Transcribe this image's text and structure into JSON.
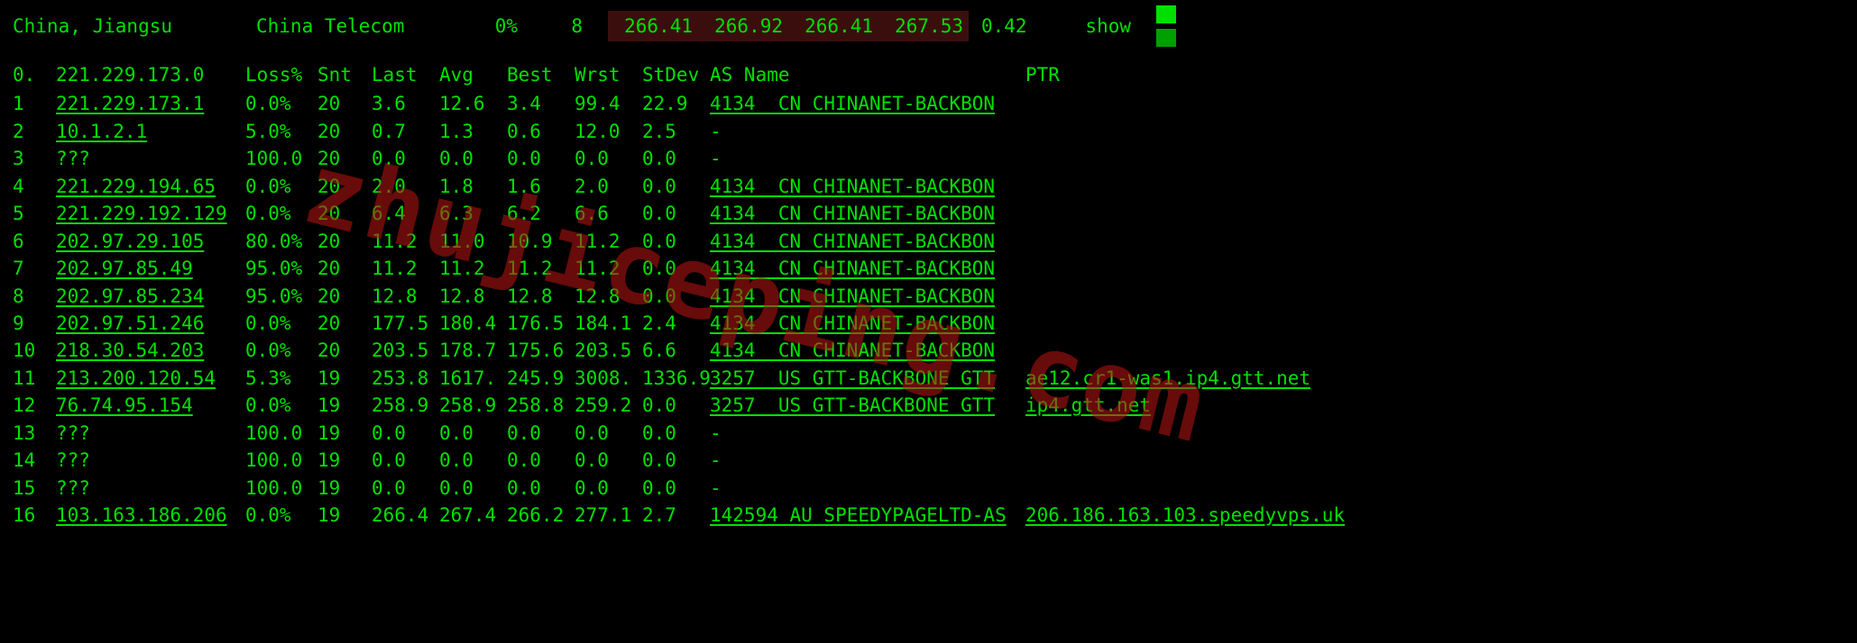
{
  "watermark": "zhujiceping.com",
  "status": {
    "location": "China, Jiangsu",
    "isp": "China Telecom",
    "loss_pct": "0%",
    "count": "8",
    "lat1": "266.41",
    "lat2": "266.92",
    "lat3": "266.41",
    "lat4": "267.53",
    "stdev": "0.42",
    "action": "show"
  },
  "headers": {
    "hop": "0.",
    "ip": "221.229.173.0",
    "loss": "Loss%",
    "snt": "Snt",
    "last": "Last",
    "avg": "Avg",
    "best": "Best",
    "wrst": "Wrst",
    "stdev": "StDev",
    "asname": "AS Name",
    "ptr": "PTR"
  },
  "hops": [
    {
      "n": "1",
      "ip": "221.229.173.1",
      "loss": "0.0%",
      "snt": "20",
      "last": "3.6",
      "avg": "12.6",
      "best": "3.4",
      "wrst": "99.4",
      "stdev": "22.9",
      "as": "4134  CN CHINANET-BACKBON",
      "ptr": ""
    },
    {
      "n": "2",
      "ip": "10.1.2.1",
      "loss": "5.0%",
      "snt": "20",
      "last": "0.7",
      "avg": "1.3",
      "best": "0.6",
      "wrst": "12.0",
      "stdev": "2.5",
      "as": "-",
      "ptr": ""
    },
    {
      "n": "3",
      "ip": "???",
      "loss": "100.0",
      "snt": "20",
      "last": "0.0",
      "avg": "0.0",
      "best": "0.0",
      "wrst": "0.0",
      "stdev": "0.0",
      "as": "-",
      "ptr": ""
    },
    {
      "n": "4",
      "ip": "221.229.194.65",
      "loss": "0.0%",
      "snt": "20",
      "last": "2.0",
      "avg": "1.8",
      "best": "1.6",
      "wrst": "2.0",
      "stdev": "0.0",
      "as": "4134  CN CHINANET-BACKBON",
      "ptr": ""
    },
    {
      "n": "5",
      "ip": "221.229.192.129",
      "loss": "0.0%",
      "snt": "20",
      "last": "6.4",
      "avg": "6.3",
      "best": "6.2",
      "wrst": "6.6",
      "stdev": "0.0",
      "as": "4134  CN CHINANET-BACKBON",
      "ptr": ""
    },
    {
      "n": "6",
      "ip": "202.97.29.105",
      "loss": "80.0%",
      "snt": "20",
      "last": "11.2",
      "avg": "11.0",
      "best": "10.9",
      "wrst": "11.2",
      "stdev": "0.0",
      "as": "4134  CN CHINANET-BACKBON",
      "ptr": ""
    },
    {
      "n": "7",
      "ip": "202.97.85.49",
      "loss": "95.0%",
      "snt": "20",
      "last": "11.2",
      "avg": "11.2",
      "best": "11.2",
      "wrst": "11.2",
      "stdev": "0.0",
      "as": "4134  CN CHINANET-BACKBON",
      "ptr": ""
    },
    {
      "n": "8",
      "ip": "202.97.85.234",
      "loss": "95.0%",
      "snt": "20",
      "last": "12.8",
      "avg": "12.8",
      "best": "12.8",
      "wrst": "12.8",
      "stdev": "0.0",
      "as": "4134  CN CHINANET-BACKBON",
      "ptr": ""
    },
    {
      "n": "9",
      "ip": "202.97.51.246",
      "loss": "0.0%",
      "snt": "20",
      "last": "177.5",
      "avg": "180.4",
      "best": "176.5",
      "wrst": "184.1",
      "stdev": "2.4",
      "as": "4134  CN CHINANET-BACKBON",
      "ptr": ""
    },
    {
      "n": "10",
      "ip": "218.30.54.203",
      "loss": "0.0%",
      "snt": "20",
      "last": "203.5",
      "avg": "178.7",
      "best": "175.6",
      "wrst": "203.5",
      "stdev": "6.6",
      "as": "4134  CN CHINANET-BACKBON",
      "ptr": ""
    },
    {
      "n": "11",
      "ip": "213.200.120.54",
      "loss": "5.3%",
      "snt": "19",
      "last": "253.8",
      "avg": "1617.",
      "best": "245.9",
      "wrst": "3008.",
      "stdev": "1336.9",
      "as": "3257  US GTT-BACKBONE GTT",
      "ptr": "ae12.cr1-was1.ip4.gtt.net"
    },
    {
      "n": "12",
      "ip": "76.74.95.154",
      "loss": "0.0%",
      "snt": "19",
      "last": "258.9",
      "avg": "258.9",
      "best": "258.8",
      "wrst": "259.2",
      "stdev": "0.0",
      "as": "3257  US GTT-BACKBONE GTT",
      "ptr": "ip4.gtt.net"
    },
    {
      "n": "13",
      "ip": "???",
      "loss": "100.0",
      "snt": "19",
      "last": "0.0",
      "avg": "0.0",
      "best": "0.0",
      "wrst": "0.0",
      "stdev": "0.0",
      "as": "-",
      "ptr": ""
    },
    {
      "n": "14",
      "ip": "???",
      "loss": "100.0",
      "snt": "19",
      "last": "0.0",
      "avg": "0.0",
      "best": "0.0",
      "wrst": "0.0",
      "stdev": "0.0",
      "as": "-",
      "ptr": ""
    },
    {
      "n": "15",
      "ip": "???",
      "loss": "100.0",
      "snt": "19",
      "last": "0.0",
      "avg": "0.0",
      "best": "0.0",
      "wrst": "0.0",
      "stdev": "0.0",
      "as": "-",
      "ptr": ""
    },
    {
      "n": "16",
      "ip": "103.163.186.206",
      "loss": "0.0%",
      "snt": "19",
      "last": "266.4",
      "avg": "267.4",
      "best": "266.2",
      "wrst": "277.1",
      "stdev": "2.7",
      "as": "142594 AU SPEEDYPAGELTD-AS",
      "ptr": "206.186.163.103.speedyvps.uk"
    }
  ]
}
